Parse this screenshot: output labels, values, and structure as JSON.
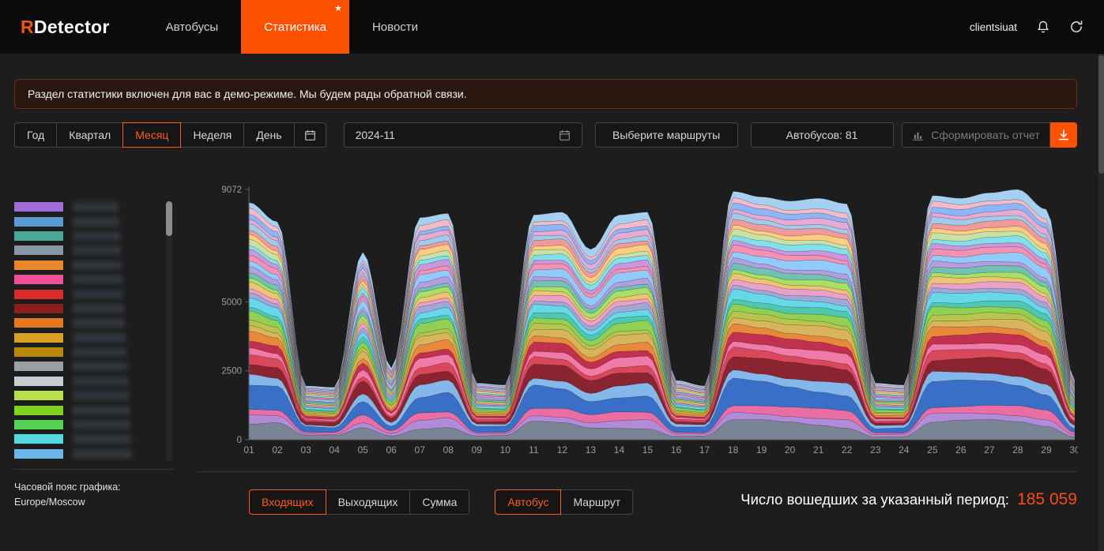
{
  "colors": {
    "accent": "#ff5200",
    "active_option": "#ff5c1f",
    "total_value": "#ff4b12"
  },
  "header": {
    "logo_r": "R",
    "logo_rest": "Detector",
    "nav": [
      {
        "label": "Автобусы",
        "active": false
      },
      {
        "label": "Статистика",
        "active": true
      },
      {
        "label": "Новости",
        "active": false
      }
    ],
    "username": "clientsiuat"
  },
  "banner": {
    "text": "Раздел статистики включен для вас в демо-режиме. Мы будем рады обратной связи."
  },
  "toolbar": {
    "period_options": [
      {
        "label": "Год",
        "active": false
      },
      {
        "label": "Квартал",
        "active": false
      },
      {
        "label": "Месяц",
        "active": true
      },
      {
        "label": "Неделя",
        "active": false
      },
      {
        "label": "День",
        "active": false
      }
    ],
    "date_value": "2024-11",
    "routes_button": "Выберите маршруты",
    "buses_button": "Автобусов: 81",
    "report_button": "Сформировать отчет"
  },
  "legend": {
    "swatch_colors": [
      "#a06cd5",
      "#5b9bd5",
      "#4aa89b",
      "#8a97a3",
      "#e8872b",
      "#f04f98",
      "#d92b2b",
      "#8f1d1d",
      "#e87820",
      "#d8a020",
      "#b8860b",
      "#9aa0a6",
      "#c8ccd0",
      "#b8e04a",
      "#7ed321",
      "#56d156",
      "#55d8e0",
      "#6ab8e8"
    ],
    "timezone_label": "Часовой пояс графика:",
    "timezone_value": "Europe/Moscow"
  },
  "chart_data": {
    "type": "area",
    "stacked": true,
    "x_labels": [
      "01",
      "02",
      "03",
      "04",
      "05",
      "06",
      "07",
      "08",
      "09",
      "10",
      "11",
      "12",
      "13",
      "14",
      "15",
      "16",
      "17",
      "18",
      "19",
      "20",
      "21",
      "22",
      "23",
      "24",
      "25",
      "26",
      "27",
      "28",
      "29",
      "30"
    ],
    "totals": [
      8600,
      7900,
      1950,
      1900,
      6800,
      2600,
      8050,
      8200,
      2050,
      1980,
      8150,
      8250,
      6900,
      8150,
      8250,
      2150,
      1950,
      9000,
      8800,
      8650,
      8750,
      8550,
      2050,
      1980,
      8850,
      8750,
      8950,
      9072,
      8350,
      2150
    ],
    "y_ticks": [
      0,
      2500,
      5000,
      9072
    ],
    "y_max": 9072,
    "layer_colors": [
      "#7b8494",
      "#b08bd8",
      "#e86ea4",
      "#3a6fc8",
      "#85b8ea",
      "#8a2430",
      "#d8475a",
      "#f07ba8",
      "#c23050",
      "#e8883c",
      "#d8b55c",
      "#b8c44e",
      "#90d052",
      "#50c8b0",
      "#66d8e8",
      "#a0a8da",
      "#e8a2c8",
      "#f0c275",
      "#a8e065",
      "#72c2b4",
      "#b49ede",
      "#92cbfa",
      "#f492b2",
      "#cf95da",
      "#82dfeb",
      "#c6e2a6",
      "#ffcd82",
      "#f09b9b",
      "#a2cbe9",
      "#e7aad2",
      "#8cb6f9",
      "#f3bac8",
      "#a5d0f2"
    ],
    "layer_weights": [
      6,
      3,
      3,
      8,
      4,
      5,
      3,
      3,
      3,
      3,
      3,
      2,
      3,
      2,
      3,
      2,
      2,
      2,
      2,
      2,
      2,
      3,
      2,
      2,
      2,
      2,
      2,
      2,
      2,
      2,
      2,
      2,
      3
    ]
  },
  "bottom": {
    "direction_options": [
      {
        "label": "Входящих",
        "active": true
      },
      {
        "label": "Выходящих",
        "active": false
      },
      {
        "label": "Сумма",
        "active": false
      }
    ],
    "mode_options": [
      {
        "label": "Автобус",
        "active": true
      },
      {
        "label": "Маршрут",
        "active": false
      }
    ],
    "total_label": "Число вошедших за указанный период:",
    "total_value": "185 059"
  }
}
